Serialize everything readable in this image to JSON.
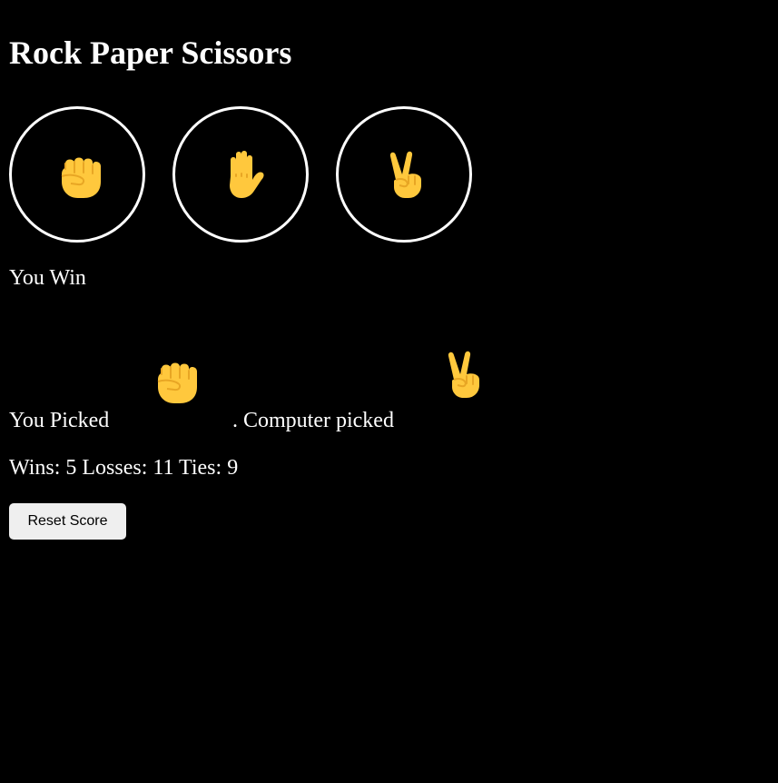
{
  "page": {
    "title": "Rock Paper Scissors"
  },
  "moves": [
    {
      "name": "rock",
      "icon": "rock-fist-icon"
    },
    {
      "name": "paper",
      "icon": "paper-hand-icon"
    },
    {
      "name": "scissors",
      "icon": "scissors-victory-icon"
    }
  ],
  "result": {
    "text": "You Win"
  },
  "picks": {
    "player_prefix": "You Picked",
    "player_icon": "rock-fist-icon",
    "computer_prefix": ". Computer picked",
    "computer_icon": "scissors-victory-icon"
  },
  "score": {
    "text": "Wins: 5 Losses: 11 Ties: 9",
    "wins": 5,
    "losses": 11,
    "ties": 9
  },
  "controls": {
    "reset_label": "Reset Score"
  },
  "colors": {
    "background": "#000000",
    "text": "#ffffff",
    "emoji_fill": "#FFC83D",
    "emoji_shade": "#E8A624",
    "button_bg": "#efefef"
  }
}
